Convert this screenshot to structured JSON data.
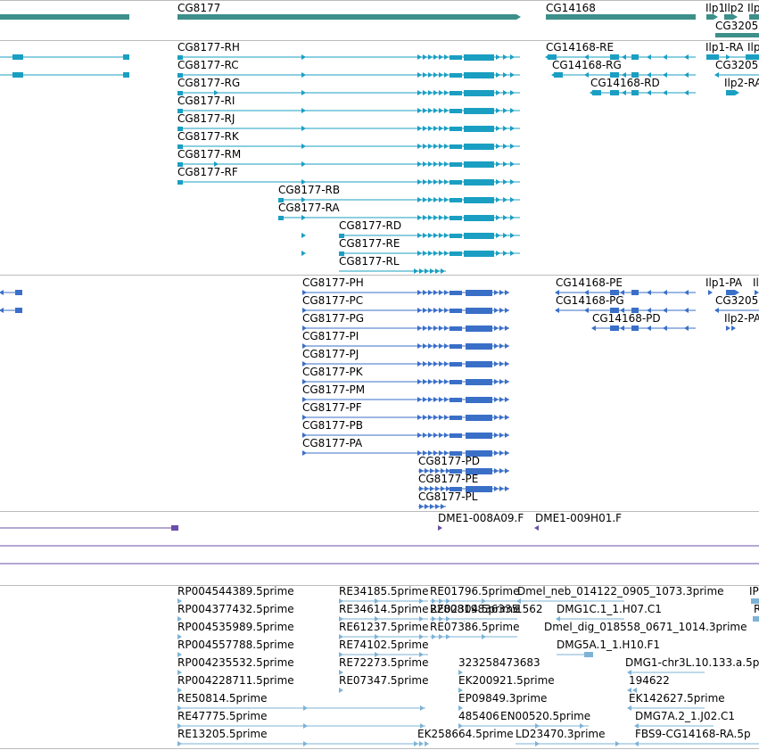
{
  "colors": {
    "gene": "#3d8f8a",
    "transcript": "#1a9fc2",
    "protein": "#3a6fc8",
    "clone": "#6a4fa8",
    "est": "#7eb3d6",
    "separator": "#bbbbbb"
  },
  "tracks": {
    "genes": {
      "labels": [
        "CG8177",
        "CG14168",
        "Ilp1",
        "Ilp2",
        "Ilp",
        "CG3205"
      ]
    },
    "transcripts": {
      "labels": [
        "CG8177-RH",
        "CG8177-RC",
        "CG8177-RG",
        "CG8177-RI",
        "CG8177-RJ",
        "CG8177-RK",
        "CG8177-RM",
        "CG8177-RF",
        "CG8177-RB",
        "CG8177-RA",
        "CG8177-RD",
        "CG8177-RE",
        "CG8177-RL",
        "CG14168-RE",
        "CG14168-RG",
        "CG14168-RD",
        "Ilp1-RA",
        "Ilp",
        "CG3205",
        "Ilp2-RA"
      ]
    },
    "proteins": {
      "labels": [
        "CG8177-PH",
        "CG8177-PC",
        "CG8177-PG",
        "CG8177-PI",
        "CG8177-PJ",
        "CG8177-PK",
        "CG8177-PM",
        "CG8177-PF",
        "CG8177-PB",
        "CG8177-PA",
        "CG8177-PD",
        "CG8177-PE",
        "CG8177-PL",
        "CG14168-PE",
        "CG14168-PG",
        "CG14168-PD",
        "Ilp1-PA",
        "Il",
        "CG3205",
        "Ilp2-PA"
      ]
    },
    "clones": {
      "labels": [
        "DME1-008A09.F",
        "DME1-009H01.F"
      ]
    },
    "ests": {
      "labels": [
        "RP004544389.5prime",
        "RP004377432.5prime",
        "RP004535989.5prime",
        "RP004557788.5prime",
        "RP004235532.5prime",
        "RP004228711.5prime",
        "RE50814.5prime",
        "RE47775.5prime",
        "RE13205.5prime",
        "RE34185.5prime",
        "RE34614.5prime",
        "RE61237.5prime",
        "RE74102.5prime",
        "RE72273.5prime",
        "RE07347.5prime",
        "RE01796.5prime",
        "RE02304.5prime",
        "RE07386.5prime",
        "2280819836335",
        "1562",
        "323258473683",
        "EK200921.5prime",
        "EP09849.3prime",
        "485406",
        "EN00520.5prime",
        "EK258664.5prime",
        "LD23470.3prime",
        "Dmel_neb_014122_0905_1073.3prime",
        "Dmel_dig_018558_0671_1014.3prime",
        "DMG1C.1_1.H07.C1",
        "DMG5A.1_1.H10.F1",
        "DMG1-chr3L.10.133.a.5p",
        "194622",
        "EK142627.5prime",
        "DMG7A.2_1.J02.C1",
        "FBS9-CG14168-RA.5p",
        "IP",
        "R"
      ]
    }
  }
}
